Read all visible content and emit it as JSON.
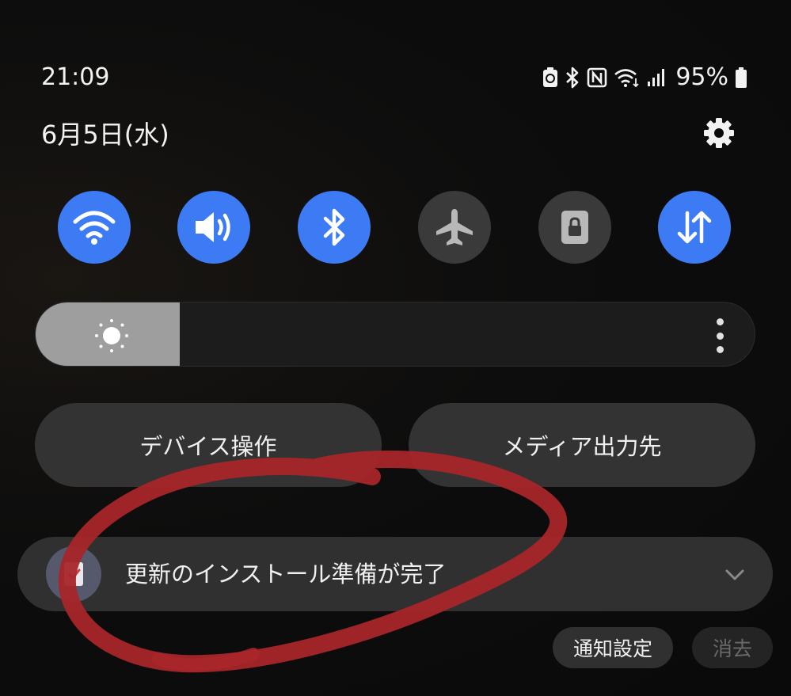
{
  "status_bar": {
    "time": "21:09",
    "battery_percent": "95%",
    "icons": [
      "battery-saver-icon",
      "bluetooth-icon",
      "nfc-icon",
      "wifi-data-icon",
      "signal-icon",
      "battery-icon"
    ]
  },
  "header": {
    "date": "6月5日(水)",
    "settings_icon": "gear-icon"
  },
  "quick_tiles": [
    {
      "name": "wifi",
      "icon": "wifi-icon",
      "state": "on"
    },
    {
      "name": "sound",
      "icon": "speaker-icon",
      "state": "on"
    },
    {
      "name": "bluetooth",
      "icon": "bluetooth-icon",
      "state": "on"
    },
    {
      "name": "airplane",
      "icon": "airplane-icon",
      "state": "off"
    },
    {
      "name": "rotation-lock",
      "icon": "lock-icon",
      "state": "off"
    },
    {
      "name": "mobile-data",
      "icon": "data-arrows-icon",
      "state": "on"
    }
  ],
  "brightness": {
    "level": 0.2,
    "icon": "sun-icon"
  },
  "pill_buttons": {
    "device_control": "デバイス操作",
    "media_output": "メディア出力先"
  },
  "notification": {
    "title": "更新のインストール準備が完了",
    "app_icon": "update-icon"
  },
  "notification_actions": {
    "settings": "通知設定",
    "clear": "消去"
  },
  "colors": {
    "tile_on": "#3d7bf5",
    "tile_off": "#3a3a3a",
    "annotation": "#a8262a"
  }
}
